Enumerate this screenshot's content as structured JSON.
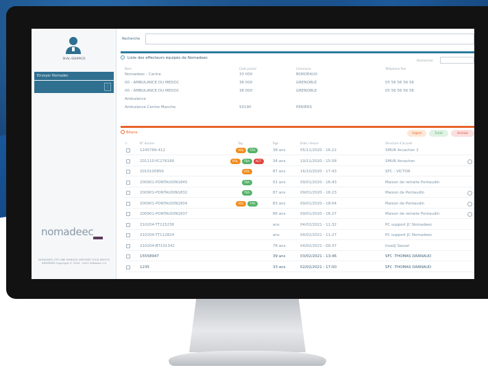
{
  "sidebar": {
    "user_name": "ShAL-SSHPACE",
    "nav_active": "Envoyer Nomadec",
    "kebab": "⋮",
    "logo": "nomadeec",
    "footer": "NOMADEEC EST UNE MARQUE DÉPOSÉE TOUS DROITS RÉSERVÉS Copyright © 2016 - 2021 Software 1.0"
  },
  "search": {
    "label": "Recherche",
    "placeholder": ""
  },
  "panel1": {
    "title": "Liste des effecteurs équipés de Nomadeec",
    "filter_label": "Recherche",
    "headers": [
      "Nom",
      "Code postal",
      "Commune",
      "Téléphone fixe"
    ],
    "rows": [
      [
        "Nomadeec - Carine",
        "33 000",
        "BORDEAUX",
        ""
      ],
      [
        "00 - AMBULANCE DU MEDOC",
        "38 000",
        "GRENOBLE",
        "05 56 56 56 56"
      ],
      [
        "00 - AMBULANCE DU MEDOC",
        "38 000",
        "GRENOBLE",
        "05 56 56 56 56"
      ],
      [
        "Ambulance",
        "",
        "",
        ""
      ],
      [
        "Ambulance Centre Manche",
        "50190",
        "PERIERS",
        ""
      ]
    ]
  },
  "panel2": {
    "title": "Bilans",
    "legend": [
      "Urgent",
      "Traité",
      "Archivé"
    ],
    "headers": [
      "N° dossier",
      "Tag",
      "Âge",
      "Date / Heure",
      "Structure d'accueil"
    ],
    "rows": [
      {
        "id": "1245789-412",
        "tags": [
          "VOL",
          "TRA"
        ],
        "age": "38 ans",
        "date": "05/11/2020 - 16:22",
        "dest": "SMUR Arcachon 2",
        "icon": false,
        "dark": false
      },
      {
        "id": "201110-YC276180",
        "tags": [
          "VOL",
          "TRA",
          "ACT"
        ],
        "age": "34 ans",
        "date": "10/11/2020 - 15:58",
        "dest": "SMUR Arcachon",
        "icon": true,
        "dark": false
      },
      {
        "id": "2010100856",
        "tags": [
          "VOL"
        ],
        "age": "87 ans",
        "date": "16/10/2020 - 17:43",
        "dest": "SFC - VICTOR",
        "icon": false,
        "dark": false
      },
      {
        "id": "200901-PONTAUDIN1845",
        "tags": [
          "TRA"
        ],
        "age": "01 ans",
        "date": "09/01/2020 - 16:43",
        "dest": "Maison de retraite Pontaudin",
        "icon": false,
        "dark": false
      },
      {
        "id": "200901-PONTAUDIN1832",
        "tags": [
          "TRA"
        ],
        "age": "87 ans",
        "date": "09/01/2020 - 16:23",
        "dest": "Maison de Pontaudin",
        "icon": true,
        "dark": false
      },
      {
        "id": "200901-PONTAUDIN1804",
        "tags": [
          "VOL",
          "TRA"
        ],
        "age": "83 ans",
        "date": "09/01/2020 - 18:04",
        "dest": "Maison de Pontaudin",
        "icon": true,
        "dark": false
      },
      {
        "id": "200901-PONTAUDIN1837",
        "tags": [],
        "age": "86 ans",
        "date": "09/01/2020 - 16:27",
        "dest": "Maison de retraite Pontaudin",
        "icon": true,
        "dark": false
      },
      {
        "id": "210204-TT115236",
        "tags": [],
        "age": "ans",
        "date": "04/02/2021 - 11:32",
        "dest": "PC support JC Nomadeec",
        "icon": false,
        "dark": false
      },
      {
        "id": "210204-TT112824",
        "tags": [],
        "age": "ans",
        "date": "04/02/2021 - 11:27",
        "dest": "PC support JC Nomadeec",
        "icon": false,
        "dark": false
      },
      {
        "id": "210204-BT101342",
        "tags": [],
        "age": "78 ans",
        "date": "04/02/2021 - 09:37",
        "dest": "Inselji Sassal",
        "icon": false,
        "dark": false
      },
      {
        "id": "15558947",
        "tags": [],
        "age": "39 ans",
        "date": "03/02/2021 - 13:46",
        "dest": "SFC -THOMAS DARNAUD",
        "icon": false,
        "dark": true
      },
      {
        "id": "1235",
        "tags": [],
        "age": "33 ans",
        "date": "02/02/2021 - 17:00",
        "dest": "SFC -THOMAS DARNAUD",
        "icon": false,
        "dark": true
      }
    ]
  },
  "colors": {
    "accent_blue": "#2a7a9e",
    "accent_orange": "#e8622a",
    "tag_vol": "#f28c1c",
    "tag_tra": "#55b26b",
    "tag_act": "#e2453c"
  }
}
